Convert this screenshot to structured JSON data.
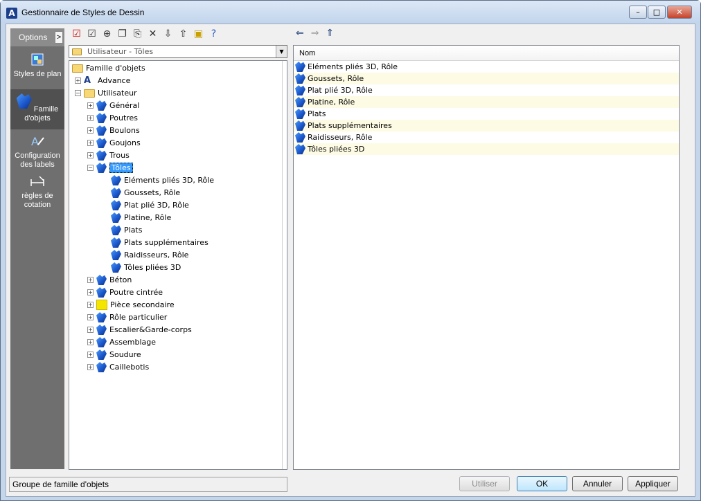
{
  "window": {
    "title": "Gestionnaire de Styles de Dessin",
    "controls": {
      "minimize": "–",
      "maximize": "□",
      "close": "✕"
    }
  },
  "sidebar": {
    "header": "Options",
    "toggle": ">",
    "items": [
      {
        "label": "Styles de plan",
        "icon": "styles-plan-icon",
        "active": false
      },
      {
        "label": "Famille d'objets",
        "icon": "object-family-icon",
        "active": true
      },
      {
        "label": "Configuration des labels",
        "icon": "labels-config-icon",
        "active": false
      },
      {
        "label": "règles de cotation",
        "icon": "dimension-rules-icon",
        "active": false
      }
    ]
  },
  "toolbar": {
    "buttons": [
      "checkbox-icon",
      "edit-check-icon",
      "add-icon",
      "copy-icon",
      "paste-icon",
      "delete-icon",
      "import-icon",
      "export-icon",
      "display-icon",
      "help-icon"
    ],
    "nav": [
      "back-arrow-icon",
      "forward-arrow-icon",
      "up-arrow-icon"
    ]
  },
  "combo": {
    "value": "Utilisateur - Tôles"
  },
  "tree": {
    "root": "Famille d'objets",
    "advance": "Advance",
    "user": "Utilisateur",
    "user_children": [
      "Général",
      "Poutres",
      "Boulons",
      "Goujons",
      "Trous"
    ],
    "selected": "Tôles",
    "toles_children": [
      "Eléments pliés 3D, Rôle",
      "Goussets, Rôle",
      "Plat plié 3D, Rôle",
      "Platine, Rôle",
      "Plats",
      "Plats supplémentaires",
      "Raidisseurs, Rôle",
      "Tôles pliées 3D"
    ],
    "after": [
      "Béton",
      "Poutre cintrée",
      "Pièce secondaire",
      "Rôle particulier",
      "Escalier&Garde-corps",
      "Assemblage",
      "Soudure",
      "Caillebotis"
    ]
  },
  "list": {
    "column": "Nom",
    "rows": [
      "Eléments pliés 3D, Rôle",
      "Goussets, Rôle",
      "Plat plié 3D, Rôle",
      "Platine, Rôle",
      "Plats",
      "Plats supplémentaires",
      "Raidisseurs, Rôle",
      "Tôles pliées 3D"
    ]
  },
  "status": "Groupe de famille d'objets",
  "buttons": {
    "use": "Utiliser",
    "ok": "OK",
    "cancel": "Annuler",
    "apply": "Appliquer"
  },
  "glyphs": {
    "expand": "+",
    "collapse": "−"
  }
}
